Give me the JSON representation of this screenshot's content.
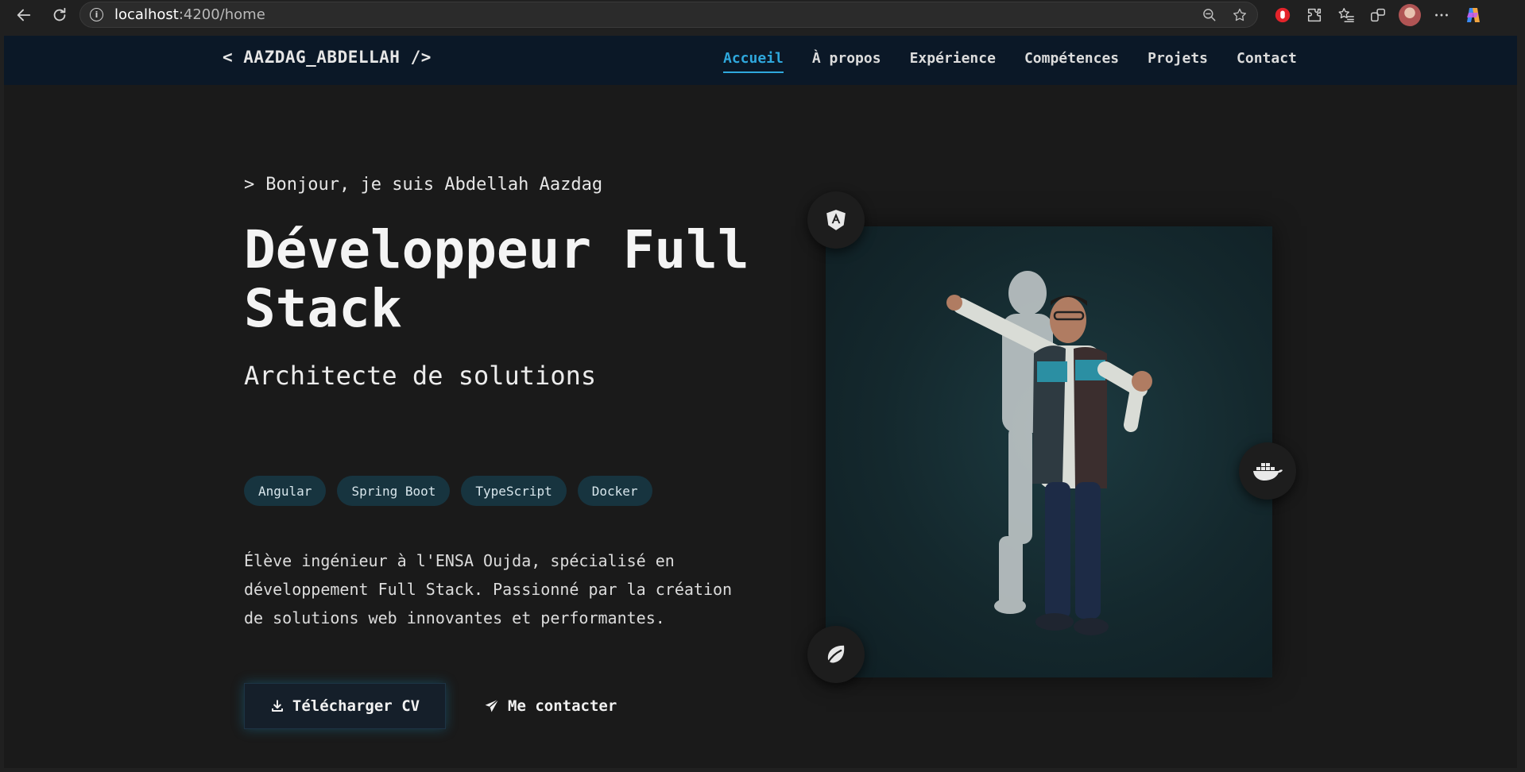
{
  "browser": {
    "url_host": "localhost",
    "url_path": ":4200/home"
  },
  "site": {
    "logo": "< AAZDAG_ABDELLAH />",
    "nav": [
      {
        "label": "Accueil",
        "active": true
      },
      {
        "label": "À propos",
        "active": false
      },
      {
        "label": "Expérience",
        "active": false
      },
      {
        "label": "Compétences",
        "active": false
      },
      {
        "label": "Projets",
        "active": false
      },
      {
        "label": "Contact",
        "active": false
      }
    ]
  },
  "hero": {
    "prompt": ">",
    "greeting": "Bonjour, je suis Abdellah Aazdag",
    "headline": "Développeur Full Stack",
    "subtitle": "Architecte de solutions",
    "tags": [
      "Angular",
      "Spring Boot",
      "TypeScript",
      "Docker"
    ],
    "description": "Élève ingénieur à l'ENSA Oujda, spécialisé en développement Full Stack. Passionné par la création de solutions web innovantes et performantes.",
    "cv_button": "Télécharger CV",
    "contact_button": "Me contacter"
  },
  "float_icons": [
    "angular-icon",
    "docker-icon",
    "spring-leaf-icon"
  ],
  "colors": {
    "accent": "#2fa8dd",
    "header_bg": "#0b1827",
    "page_bg": "#1a1a1a",
    "tag_bg": "#17343f"
  }
}
